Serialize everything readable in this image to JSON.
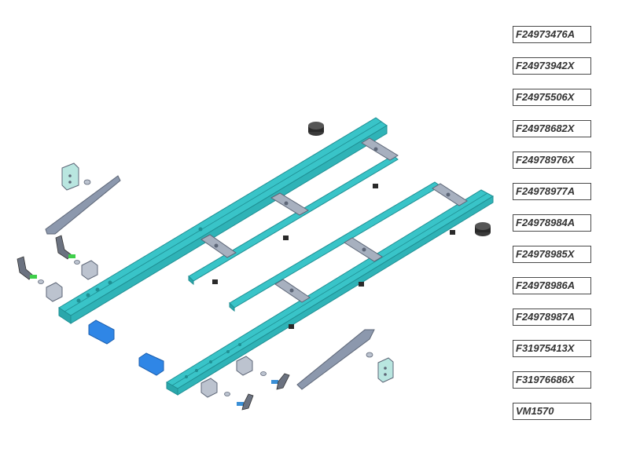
{
  "colors": {
    "frame": "#39c4c8",
    "frame_dark": "#1f8f93",
    "plate": "#8c98ad",
    "plate_dark": "#5d6677",
    "block": "#bcc3cf",
    "blue_part": "#2f86e6",
    "rubber": "#2a2a2a",
    "green_bolt": "#3fcf4a"
  },
  "parts": [
    {
      "code": "F24973476A"
    },
    {
      "code": "F24973942X"
    },
    {
      "code": "F24975506X"
    },
    {
      "code": "F24978682X"
    },
    {
      "code": "F24978976X"
    },
    {
      "code": "F24978977A"
    },
    {
      "code": "F24978984A"
    },
    {
      "code": "F24978985X"
    },
    {
      "code": "F24978986A"
    },
    {
      "code": "F24978987A"
    },
    {
      "code": "F31975413X"
    },
    {
      "code": "F31976686X"
    },
    {
      "code": "VM1570"
    }
  ]
}
